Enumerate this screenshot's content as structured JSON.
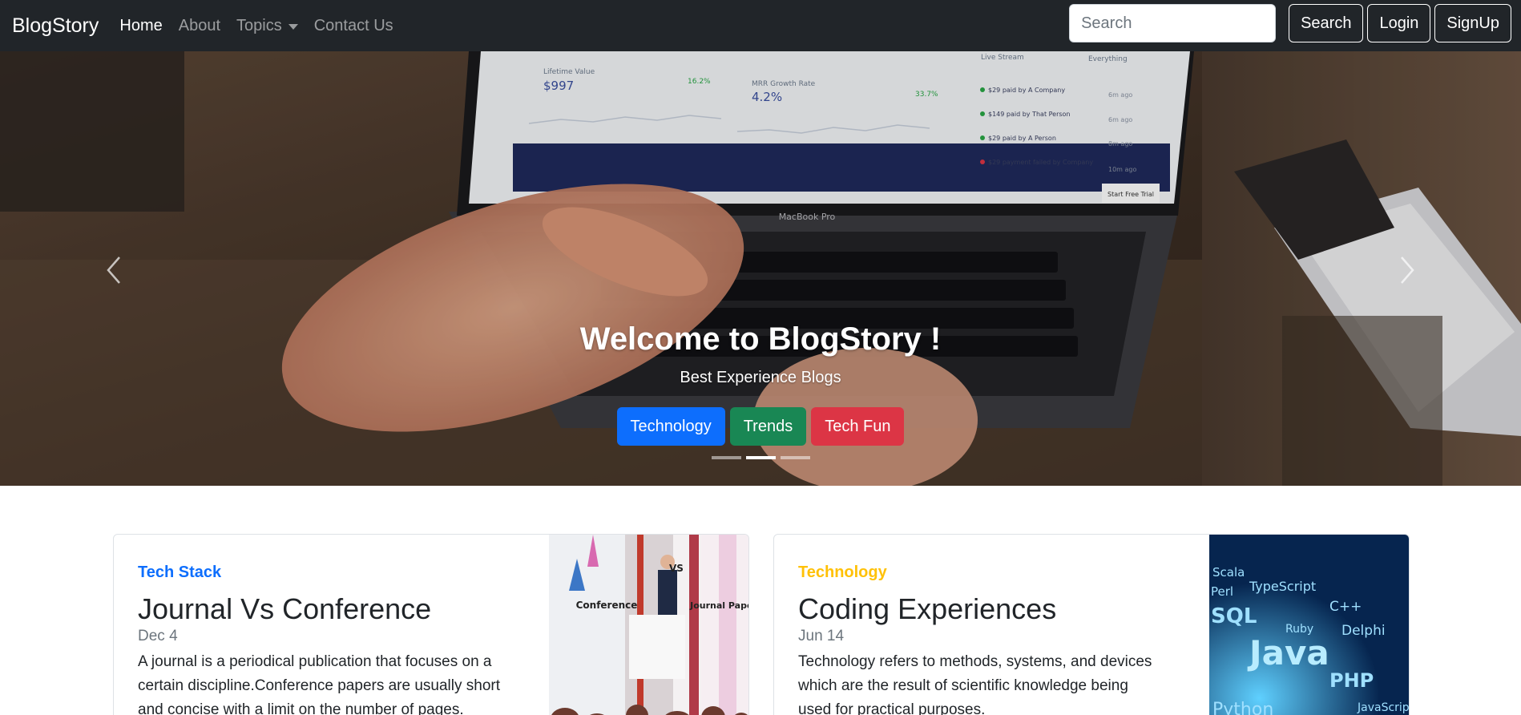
{
  "navbar": {
    "brand": "BlogStory",
    "links": [
      "Home",
      "About",
      "Topics",
      "Contact Us"
    ],
    "search_placeholder": "Search",
    "search_button": "Search",
    "login_button": "Login",
    "signup_button": "SignUp"
  },
  "hero": {
    "title": "Welcome to BlogStory !",
    "subtitle": "Best Experience Blogs",
    "buttons": [
      "Technology",
      "Trends",
      "Tech Fun"
    ],
    "button_colors": [
      "#0d6efd",
      "#198754",
      "#dc3545"
    ],
    "active_slide": 2,
    "slide_count": 3,
    "laptop_screen": {
      "lifetime_value_label": "Lifetime Value",
      "lifetime_value": "$997",
      "lifetime_change": "16.2%",
      "mrr_label": "MRR Growth Rate",
      "mrr_value": "4.2%",
      "mrr_change": "33.7%",
      "stream_title": "Live Stream",
      "stream_filter": "Everything",
      "stream_items": [
        {
          "text": "$29 paid by A Company",
          "time": "6m ago"
        },
        {
          "text": "$149 paid by That Person",
          "time": "6m ago"
        },
        {
          "text": "$29 paid by A Person",
          "time": "8m ago"
        },
        {
          "text": "$29 payment failed by Company",
          "time": "10m ago"
        }
      ],
      "trial_button": "Start Free Trial",
      "laptop_brand": "MacBook Pro"
    }
  },
  "cards": [
    {
      "category": "Tech Stack",
      "category_color": "#0d6efd",
      "title": "Journal Vs Conference",
      "date": "Dec 4",
      "text_lines": [
        "A journal is a periodical publication that focuses on a",
        "certain discipline.Conference papers are usually short",
        "and concise with a limit on the number of pages."
      ],
      "image_labels": [
        "Conference",
        "VS",
        "Journal Paper"
      ]
    },
    {
      "category": "Technology",
      "category_color": "#ffc107",
      "title": "Coding Experiences",
      "date": "Jun 14",
      "text_lines": [
        "Technology refers to methods, systems, and devices",
        "which are the result of scientific knowledge being",
        "used for practical purposes."
      ],
      "image_words": [
        "Scala",
        "Perl",
        "TypeScript",
        "C++",
        "SQL",
        "Ruby",
        "Delphi",
        "Java",
        "PHP",
        "Python",
        "JavaScript"
      ]
    }
  ]
}
